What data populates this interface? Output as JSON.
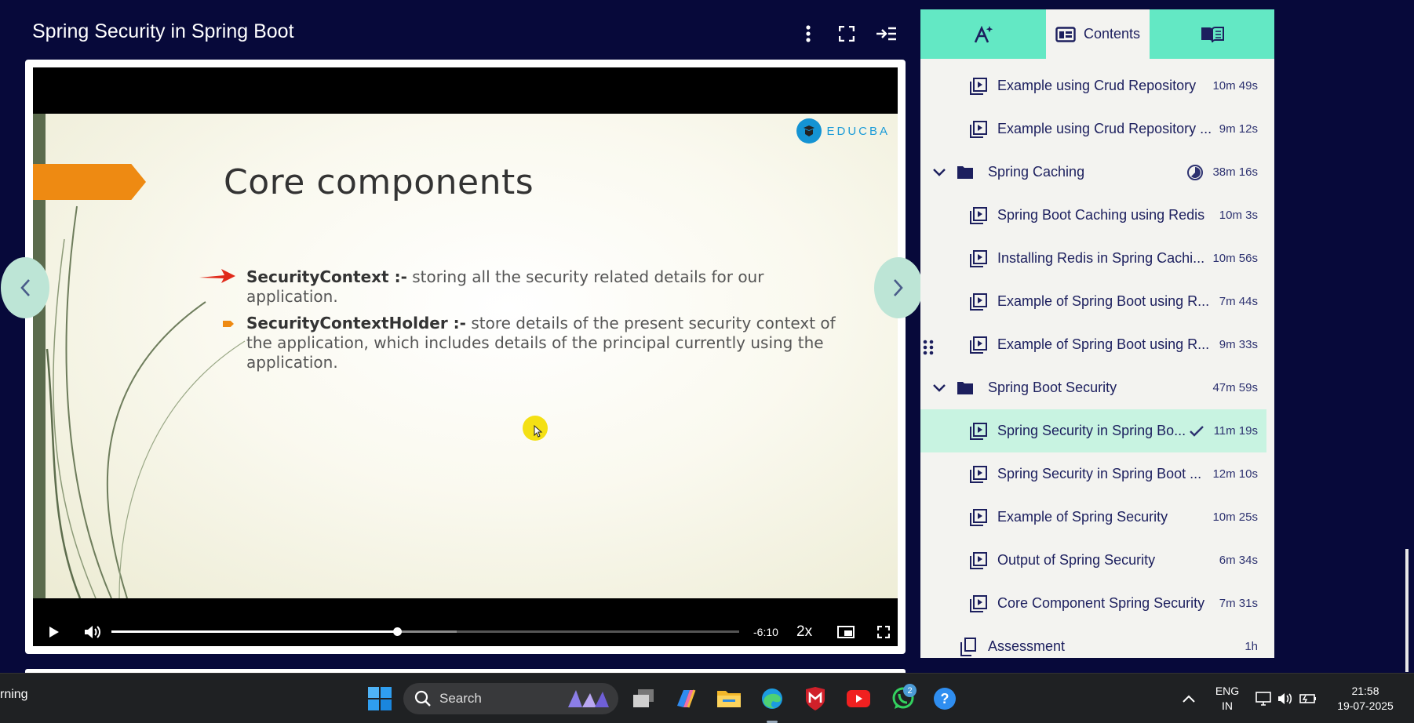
{
  "header": {
    "title": "Spring Security in Spring Boot",
    "icons": [
      "more-vertical-icon",
      "fullscreen-icon",
      "collapse-sidebar-icon"
    ]
  },
  "slide": {
    "brand": "EDUCBA",
    "title": "Core components",
    "bullets": [
      {
        "term": "SecurityContext :-",
        "text": " storing all the security related details for our application."
      },
      {
        "term": "SecurityContextHolder :-",
        "text": " store details of the present security context of the application, which includes details of the principal currently using the application."
      }
    ]
  },
  "player": {
    "time_remaining": "-6:10",
    "speed": "2x",
    "progress_fraction": 0.455,
    "buffered_fraction": 0.55
  },
  "sidebar": {
    "tabs": [
      {
        "icon": "ai-assistant-icon",
        "label": ""
      },
      {
        "icon": "contents-icon",
        "label": "Contents"
      },
      {
        "icon": "notes-book-icon",
        "label": ""
      }
    ],
    "items": [
      {
        "kind": "video",
        "label": "Example using Crud Repository",
        "duration": "10m 49s"
      },
      {
        "kind": "video",
        "label": "Example using Crud Repository ...",
        "duration": "9m 12s"
      },
      {
        "kind": "section",
        "label": "Spring Caching",
        "duration": "38m 16s",
        "progress_icon": true
      },
      {
        "kind": "video",
        "label": "Spring Boot Caching using Redis",
        "duration": "10m 3s"
      },
      {
        "kind": "video",
        "label": "Installing Redis in Spring Cachi...",
        "duration": "10m 56s"
      },
      {
        "kind": "video",
        "label": "Example of Spring Boot using R...",
        "duration": "7m 44s"
      },
      {
        "kind": "video",
        "label": "Example of Spring Boot using R...",
        "duration": "9m 33s"
      },
      {
        "kind": "section",
        "label": "Spring Boot Security",
        "duration": "47m 59s"
      },
      {
        "kind": "video",
        "label": "Spring Security in Spring Bo...",
        "duration": "11m 19s",
        "current": true,
        "completed": true
      },
      {
        "kind": "video",
        "label": "Spring Security in Spring Boot ...",
        "duration": "12m 10s"
      },
      {
        "kind": "video",
        "label": "Example of Spring Security",
        "duration": "10m 25s"
      },
      {
        "kind": "video",
        "label": "Output of Spring Security",
        "duration": "6m 34s"
      },
      {
        "kind": "video",
        "label": "Core Component Spring Security",
        "duration": "7m 31s"
      },
      {
        "kind": "assessment",
        "label": "Assessment",
        "duration": "1h"
      }
    ]
  },
  "taskbar": {
    "weather_partial": "rning",
    "search_placeholder": "Search",
    "language_line1": "ENG",
    "language_line2": "IN",
    "time": "21:58",
    "date": "19-07-2025",
    "whatsapp_badge": "2",
    "apps": [
      "windows-start-icon",
      "search-icon",
      "task-view-icon",
      "copilot-icon",
      "file-explorer-icon",
      "edge-icon",
      "mcafee-icon",
      "youtube-icon",
      "whatsapp-icon",
      "help-icon"
    ]
  }
}
